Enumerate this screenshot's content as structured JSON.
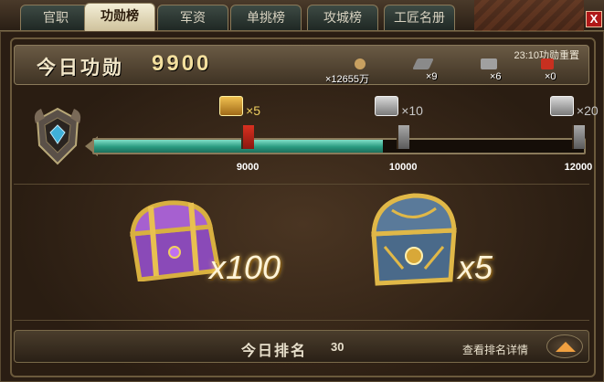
{
  "tabs": [
    {
      "label": "官职",
      "active": false
    },
    {
      "label": "功勋榜",
      "active": true
    },
    {
      "label": "军资",
      "active": false
    },
    {
      "label": "单挑榜",
      "active": false
    },
    {
      "label": "攻城榜",
      "active": false
    },
    {
      "label": "工匠名册",
      "active": false
    }
  ],
  "close_label": "X",
  "header": {
    "merit_label": "今日功勋",
    "merit_value": "9900",
    "reset_text": "23:10功勋重置",
    "resources": [
      {
        "icon": "coin-icon",
        "text": "×12655万",
        "color": "#c8a060"
      },
      {
        "icon": "iron-ingot-icon",
        "text": "×9",
        "color": "#8a8a8a"
      },
      {
        "icon": "weapons-icon",
        "text": "×6",
        "color": "#a0a0a0"
      },
      {
        "icon": "banner-icon",
        "text": "×0",
        "color": "#c83020"
      }
    ]
  },
  "progress": {
    "current": 9900,
    "min": 7000,
    "max": 12000,
    "fill_fraction": 0.59,
    "milestones": [
      {
        "value": 9000,
        "label": "9000",
        "count": "×5",
        "chest": "gold-chest-icon",
        "fraction": 0.315
      },
      {
        "value": 10000,
        "label": "10000",
        "count": "×10",
        "chest": "silver-chest-icon",
        "fraction": 0.63
      },
      {
        "value": 12000,
        "label": "12000",
        "count": "×20",
        "chest": "silver-chest-icon",
        "fraction": 0.985
      }
    ]
  },
  "rewards": [
    {
      "icon": "purple-chest-icon",
      "qty": "x100"
    },
    {
      "icon": "ornate-blue-chest-icon",
      "qty": "x5"
    }
  ],
  "bottom": {
    "rank_label": "今日排名",
    "rank_value": "30",
    "detail_link": "查看排名详情"
  },
  "colors": {
    "accent_teal": "#2a9a80",
    "gold_text": "#f3df9e",
    "close_red": "#b01818"
  }
}
